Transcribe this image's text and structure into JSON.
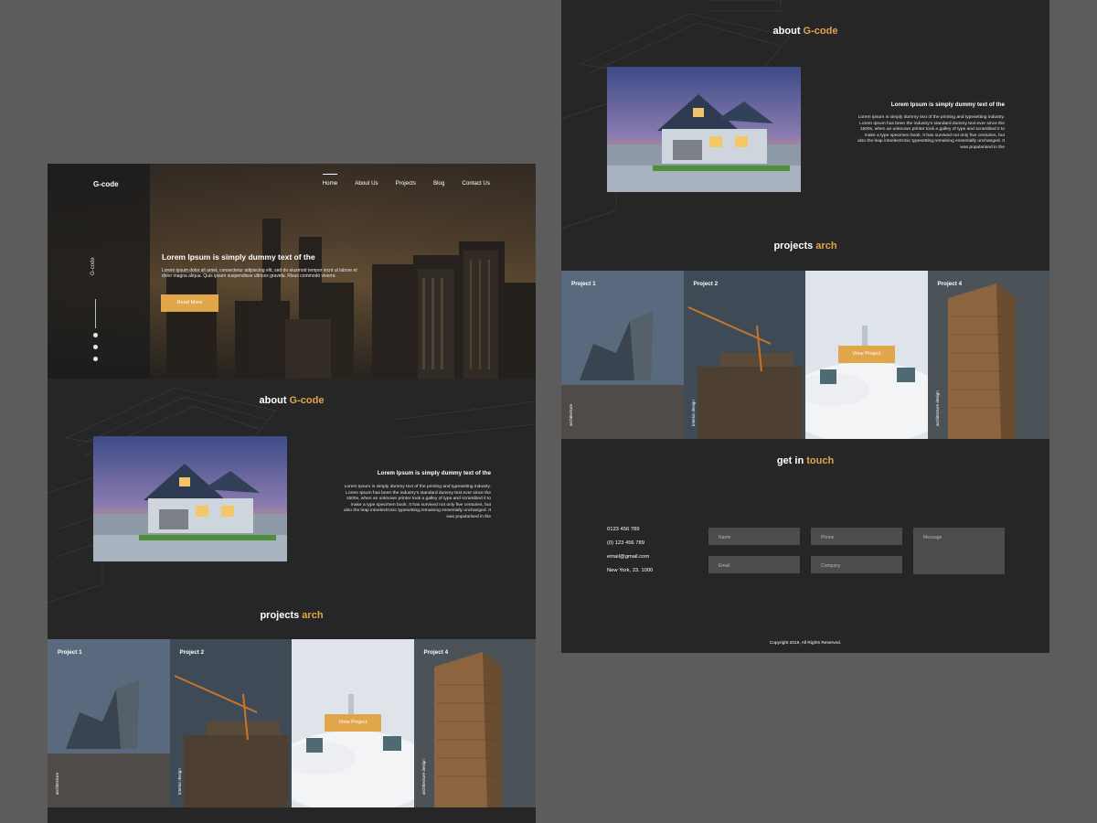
{
  "brand": {
    "logo": "G-code",
    "vertical_name": "G-code"
  },
  "nav": {
    "items": [
      "Home",
      "About Us",
      "Projects",
      "Blog",
      "Contact Us"
    ],
    "active": "Home"
  },
  "hero": {
    "title": "Lorem Ipsum is simply dummy text of the",
    "text": "Lorem ipsum dolor sit amet, consectetur adipiscing elit, sed do eiusmod tempor incnt ut labore et dolor magna aliqua. Quis ipsum suspendisse ultrices gravida. Risus commodo viverra",
    "button": "Read More"
  },
  "social_icons": [
    "facebook-icon",
    "instagram-icon",
    "twitter-icon"
  ],
  "about": {
    "title_prefix": "about ",
    "title_accent": "G-code",
    "heading": "Lorem Ipsum is simply dummy text of the",
    "text": "Lorem Ipsum is simply dummy text of the printing and typesetting industry. Lorem Ipsum has been the industry's standard dummy text ever since the 1500s, when an unknown printer took a galley of type and scrambled it to make a type specimen book. It has survived not only five centuries, but also the leap intoelectronic typesetting,remaining essentially unchanged. It was popularised in the"
  },
  "projects": {
    "title_prefix": "projects ",
    "title_accent": "arch",
    "items": [
      {
        "label": "Project 1",
        "category": "architecture"
      },
      {
        "label": "Project 2",
        "category": "interior design"
      },
      {
        "label": "",
        "category": "",
        "button": "View Project"
      },
      {
        "label": "Project 4",
        "category": "architecture design"
      }
    ]
  },
  "contact": {
    "title_prefix": "get in ",
    "title_accent": "touch",
    "info": [
      "0123 456 789",
      "(0) 123 456 789",
      "email@gmail.com",
      "New York, 23. 1000"
    ],
    "fields": {
      "name": "Name",
      "phone": "Phone",
      "email": "Email",
      "company": "Company",
      "message": "Message"
    }
  },
  "footer": {
    "copyright": "Copyright 2019, All Rights Reserved."
  },
  "colors": {
    "accent": "#e1a64a",
    "background": "#5c5c5c",
    "panel": "#262626",
    "field": "#4c4c4c"
  }
}
